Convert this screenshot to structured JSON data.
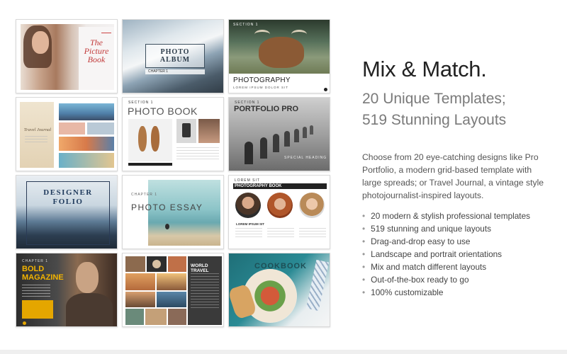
{
  "headline": "Mix & Match.",
  "subheadline": [
    "20 Unique Templates;",
    "519 Stunning Layouts"
  ],
  "description": "Choose from 20 eye-catching designs like Pro Portfolio, a modern grid-based template with large spreads; or Travel Journal, a vintage style photojournalist-inspired layouts.",
  "features": [
    "20 modern & stylish professional templates",
    "519 stunning and unique layouts",
    "Drag-and-drop easy to use",
    "Landscape and portrait orientations",
    "Mix and match different layouts",
    "Out-of-the-box ready to go",
    "100% customizable"
  ],
  "templates": {
    "picture_book": {
      "title_line1": "The",
      "title_line2": "Picture",
      "title_line3": "Book"
    },
    "photo_album": {
      "title": "PHOTO ALBUM",
      "chapter": "CHAPTER 1"
    },
    "photography": {
      "section": "SECTION 1",
      "title": "PHOTOGRAPHY",
      "subtitle": "LOREM IPSUM DOLOR SIT"
    },
    "travel_journal": {
      "title_line1": "Travel Journal"
    },
    "photo_book": {
      "section": "SECTION 1",
      "title": "PHOTO BOOK"
    },
    "portfolio_pro": {
      "section": "SECTION 1",
      "title": "PORTFOLIO PRO",
      "caption": "SPECIAL HEADING"
    },
    "designer_folio": {
      "title_line1": "DESIGNER",
      "title_line2": "FOLIO"
    },
    "photo_essay": {
      "chapter": "CHAPTER 1",
      "title": "PHOTO ESSAY"
    },
    "photography_book": {
      "header_small": "LOREM SIT",
      "title": "PHOTOGRAPHY BOOK",
      "label": "LOREM IPSUM SIT"
    },
    "bold_magazine": {
      "chapter": "CHAPTER 1",
      "title_line1": "BOLD",
      "title_line2": "MAGAZINE"
    },
    "world_travel": {
      "title": "WORLD TRAVEL"
    },
    "cookbook": {
      "title": "COOKBOOK"
    }
  }
}
